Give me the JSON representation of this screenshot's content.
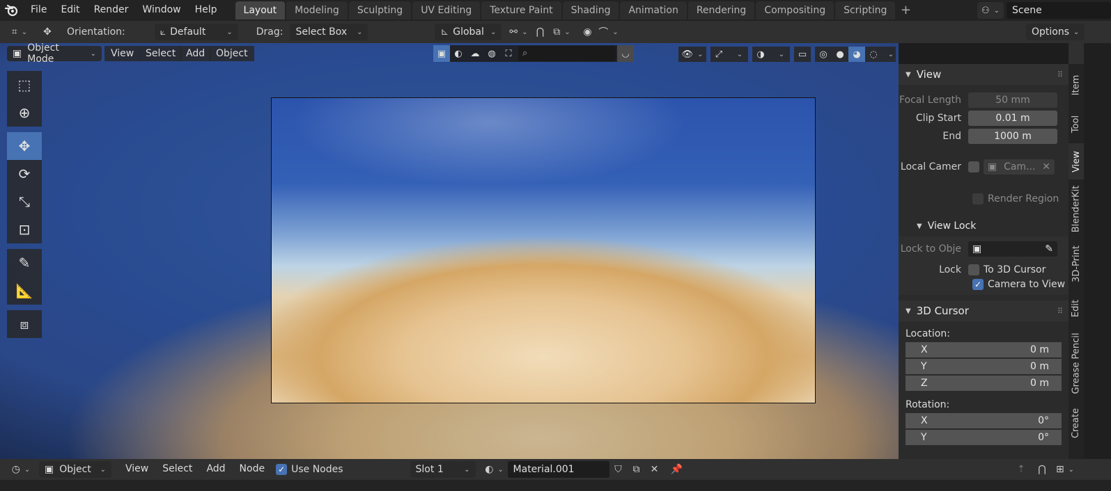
{
  "topbar": {
    "menus": [
      "File",
      "Edit",
      "Render",
      "Window",
      "Help"
    ],
    "workspaces": [
      "Layout",
      "Modeling",
      "Sculpting",
      "UV Editing",
      "Texture Paint",
      "Shading",
      "Animation",
      "Rendering",
      "Compositing",
      "Scripting"
    ],
    "active_workspace": "Layout",
    "scene_name": "Scene"
  },
  "toolheader": {
    "orientation_label": "Orientation:",
    "orientation_value": "Default",
    "drag_label": "Drag:",
    "drag_value": "Select Box",
    "transform_orientation": "Global",
    "options_label": "Options"
  },
  "viewport": {
    "mode": "Object Mode",
    "menus": [
      "View",
      "Select",
      "Add",
      "Object"
    ]
  },
  "sidebar": {
    "view_panel": {
      "title": "View",
      "focal_length_label": "Focal Length",
      "focal_length_value": "50 mm",
      "clip_start_label": "Clip Start",
      "clip_start_value": "0.01 m",
      "end_label": "End",
      "end_value": "1000 m",
      "local_camera_label": "Local Camer",
      "local_camera_value": "Cam...",
      "render_region_label": "Render Region"
    },
    "view_lock_panel": {
      "title": "View Lock",
      "lock_to_object_label": "Lock to Obje",
      "lock_label": "Lock",
      "to_3d_cursor_label": "To 3D Cursor",
      "camera_to_view_label": "Camera to View"
    },
    "cursor_panel": {
      "title": "3D Cursor",
      "location_label": "Location:",
      "location": [
        {
          "axis": "X",
          "value": "0 m"
        },
        {
          "axis": "Y",
          "value": "0 m"
        },
        {
          "axis": "Z",
          "value": "0 m"
        }
      ],
      "rotation_label": "Rotation:",
      "rotation": [
        {
          "axis": "X",
          "value": "0°"
        },
        {
          "axis": "Y",
          "value": "0°"
        }
      ]
    }
  },
  "vtabs": [
    "Item",
    "Tool",
    "View",
    "BlenderKit",
    "3D-Print",
    "Edit",
    "Grease Pencil",
    "Create"
  ],
  "active_vtab": "View",
  "bottombar": {
    "object_value": "Object",
    "menus": [
      "View",
      "Select",
      "Add",
      "Node"
    ],
    "use_nodes_label": "Use Nodes",
    "slot_value": "Slot 1",
    "material_name": "Material.001"
  },
  "colors": {
    "accent": "#4772b3",
    "header_bg": "#303030",
    "panel_bg": "#2b2b2b"
  }
}
